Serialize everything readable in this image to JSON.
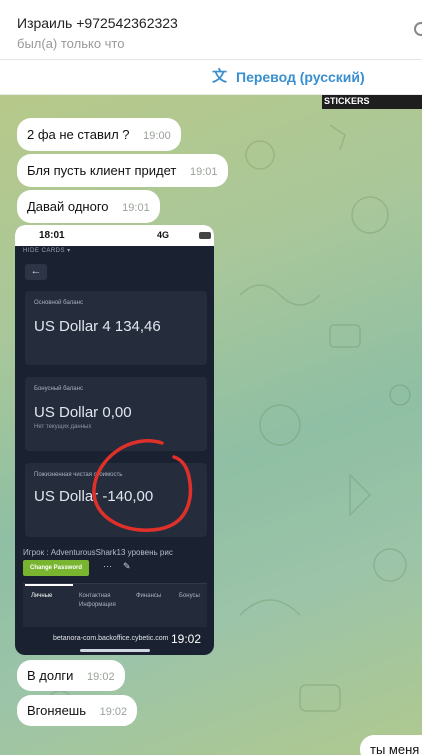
{
  "header": {
    "contact_name": "Израиль +972542362323",
    "status": "был(а) только что"
  },
  "translate_bar": {
    "label": "Перевод (русский)",
    "icon": "translate-icon"
  },
  "sticker_peek": {
    "label": "STICKERS"
  },
  "messages": [
    {
      "text": "2 фа не ставил ?",
      "time": "19:00"
    },
    {
      "text": "Бля пусть клиент придет",
      "time": "19:01"
    },
    {
      "text": "Давай одного",
      "time": "19:01"
    },
    {
      "text": "В долги",
      "time": "19:02"
    },
    {
      "text": "Вгоняешь",
      "time": "19:02"
    },
    {
      "text": "ты меня",
      "time": ""
    }
  ],
  "screenshot": {
    "time_overlay": "19:02",
    "phone_clock": "18:01",
    "network": "4G",
    "hide_cards": "HIDE CARDS ▾",
    "cards": [
      {
        "label": "Основной баланс",
        "value": "US Dollar 4 134,46",
        "sub": ""
      },
      {
        "label": "Бонусный баланс",
        "value": "US Dollar 0,00",
        "sub": "Нет текущих данных"
      },
      {
        "label": "Пожизненная чистая стоимость",
        "value": "US Dollar -140,00",
        "sub": ""
      }
    ],
    "player_line": "Игрок : AdventurousShark13 уровень рис",
    "change_password": "Change Password",
    "tabs": [
      "Личные",
      "Контактная Информация",
      "Финансы",
      "Бонусы"
    ],
    "url": "betanora-com.backoffice.cybetic.com",
    "highlight_color": "#e0302a"
  },
  "colors": {
    "accent": "#3a8fd0",
    "bubble": "#ffffff",
    "phone_bg": "#1a2130",
    "button_green": "#7ab531"
  }
}
